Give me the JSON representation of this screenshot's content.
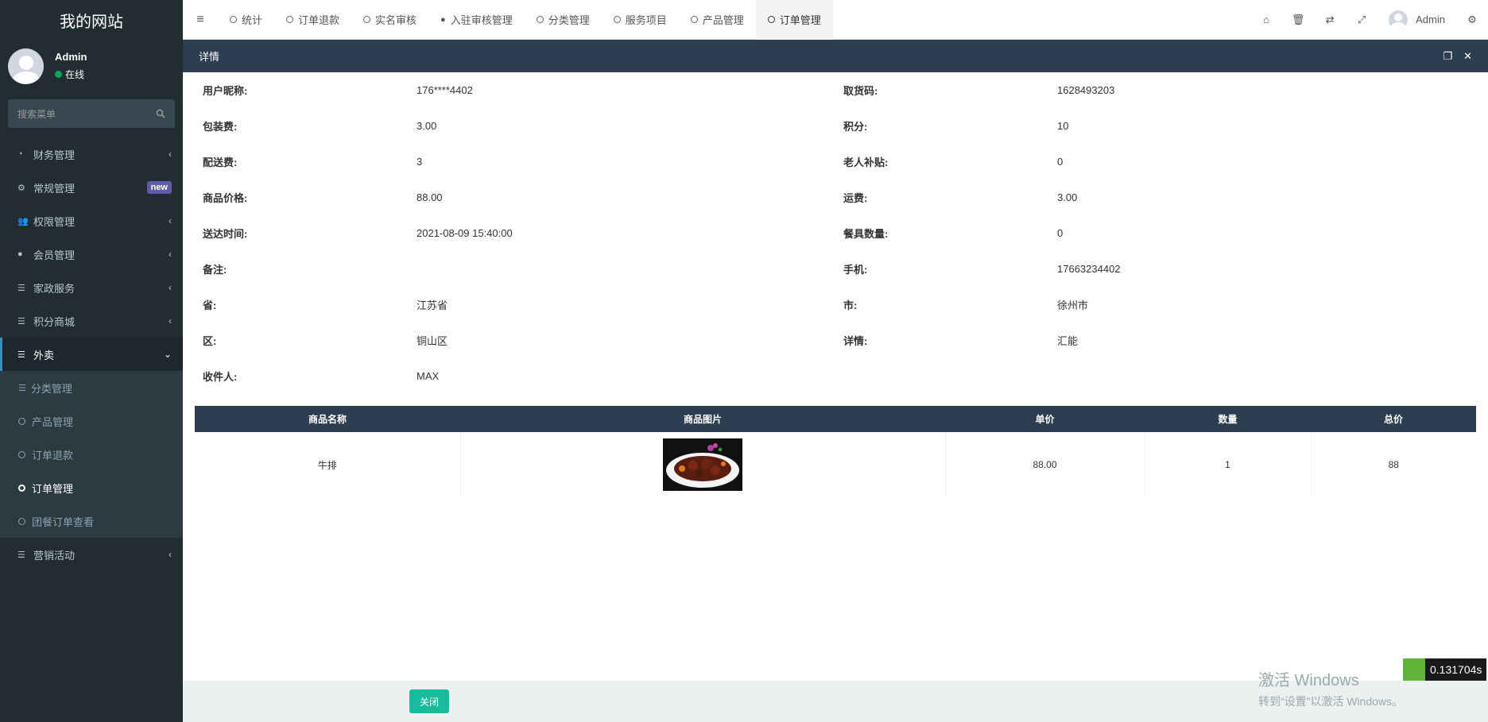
{
  "sidebar": {
    "logo": "我的网站",
    "user": {
      "name": "Admin",
      "status": "在线"
    },
    "search_placeholder": "搜索菜单",
    "menu": [
      {
        "label": "财务管理",
        "icon": "dashboard-icon",
        "arrow": "‹"
      },
      {
        "label": "常规管理",
        "icon": "cogs-icon",
        "badge": "new"
      },
      {
        "label": "权限管理",
        "icon": "users-icon",
        "arrow": "‹"
      },
      {
        "label": "会员管理",
        "icon": "user-icon",
        "arrow": "‹"
      },
      {
        "label": "家政服务",
        "icon": "list-icon",
        "arrow": "‹"
      },
      {
        "label": "积分商城",
        "icon": "list-icon",
        "arrow": "‹"
      },
      {
        "label": "外卖",
        "icon": "list-icon",
        "arrow": "⌄"
      }
    ],
    "submenu": [
      "分类管理",
      "产品管理",
      "订单退款",
      "订单管理",
      "团餐订单查看"
    ],
    "last_menu": {
      "label": "营销活动",
      "icon": "list-icon",
      "arrow": "‹"
    }
  },
  "topbar": {
    "tabs": [
      "统计",
      "订单退款",
      "实名审核",
      "入驻审核管理",
      "分类管理",
      "服务项目",
      "产品管理",
      "订单管理"
    ],
    "user": "Admin"
  },
  "dialog": {
    "title": "详情",
    "fields": [
      {
        "l1": "用户昵称:",
        "v1": "176****4402",
        "l2": "取货码:",
        "v2": "1628493203"
      },
      {
        "l1": "包装费:",
        "v1": "3.00",
        "l2": "积分:",
        "v2": "10"
      },
      {
        "l1": "配送费:",
        "v1": "3",
        "l2": "老人补贴:",
        "v2": "0"
      },
      {
        "l1": "商品价格:",
        "v1": "88.00",
        "l2": "运费:",
        "v2": "3.00"
      },
      {
        "l1": "送达时间:",
        "v1": "2021-08-09 15:40:00",
        "l2": "餐具数量:",
        "v2": "0"
      },
      {
        "l1": "备注:",
        "v1": "",
        "l2": "手机:",
        "v2": "17663234402"
      },
      {
        "l1": "省:",
        "v1": "江苏省",
        "l2": "市:",
        "v2": "徐州市"
      },
      {
        "l1": "区:",
        "v1": "铜山区",
        "l2": "详情:",
        "v2": "汇能"
      },
      {
        "l1": "收件人:",
        "v1": "MAX",
        "l2": "",
        "v2": ""
      }
    ],
    "table": {
      "headers": [
        "商品名称",
        "商品图片",
        "单价",
        "数量",
        "总价"
      ],
      "rows": [
        {
          "name": "牛排",
          "price": "88.00",
          "qty": "1",
          "total": "88"
        }
      ]
    },
    "close_label": "关闭"
  },
  "watermark": {
    "line1": "激活 Windows",
    "line2": "转到“设置”以激活 Windows。"
  },
  "timer": "0.131704s"
}
